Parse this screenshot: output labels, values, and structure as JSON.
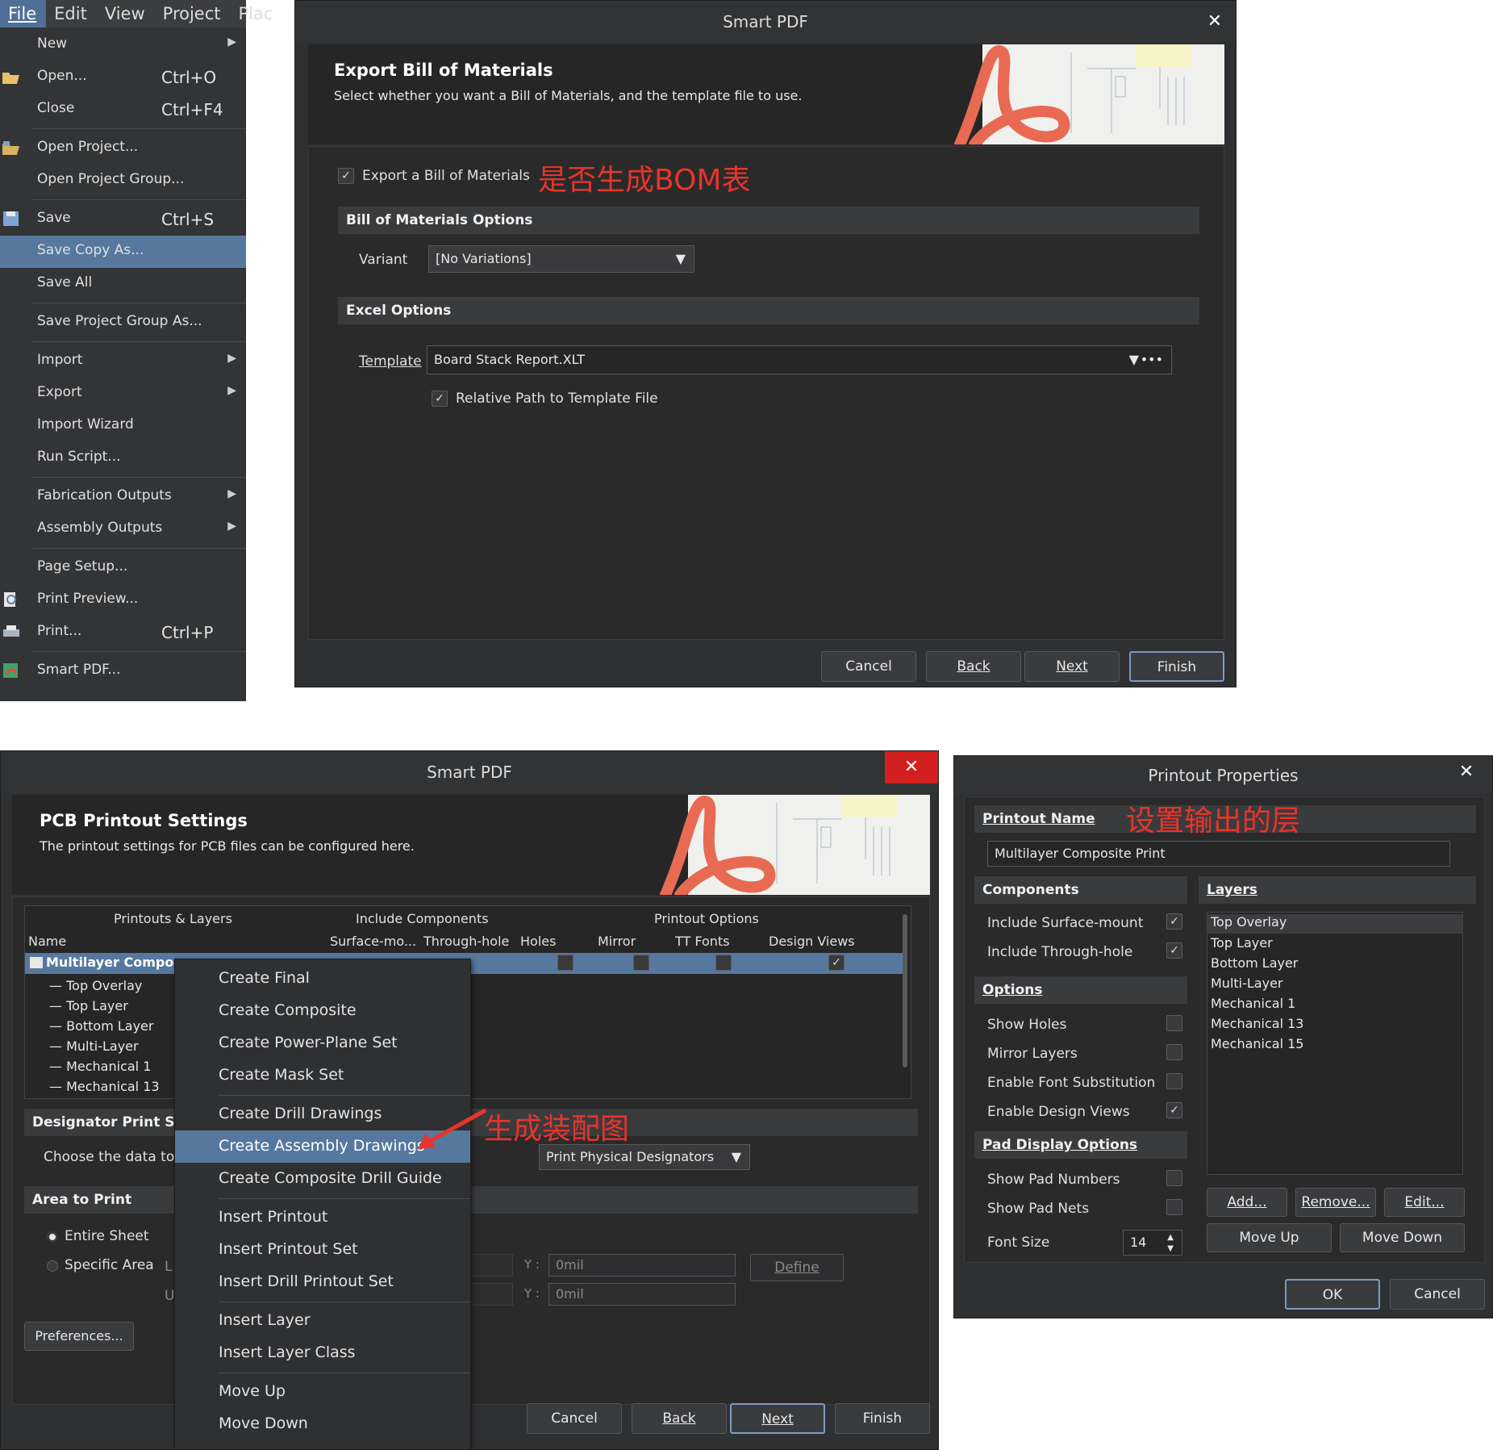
{
  "menubar": {
    "items": [
      "File",
      "Edit",
      "View",
      "Project",
      "Plac"
    ]
  },
  "file_menu": {
    "items": [
      {
        "label": "New",
        "shortcut": "",
        "submenu": true
      },
      {
        "label": "Open...",
        "shortcut": "Ctrl+O",
        "submenu": false
      },
      {
        "label": "Close",
        "shortcut": "Ctrl+F4",
        "submenu": false
      },
      {
        "label": "Open Project...",
        "shortcut": "",
        "submenu": false
      },
      {
        "label": "Open Project Group...",
        "shortcut": "",
        "submenu": false
      },
      {
        "label": "Save",
        "shortcut": "Ctrl+S",
        "submenu": false
      },
      {
        "label": "Save Copy As...",
        "shortcut": "",
        "submenu": false
      },
      {
        "label": "Save All",
        "shortcut": "",
        "submenu": false
      },
      {
        "label": "Save Project Group As...",
        "shortcut": "",
        "submenu": false
      },
      {
        "label": "Import",
        "shortcut": "",
        "submenu": true
      },
      {
        "label": "Export",
        "shortcut": "",
        "submenu": true
      },
      {
        "label": "Import Wizard",
        "shortcut": "",
        "submenu": false
      },
      {
        "label": "Run Script...",
        "shortcut": "",
        "submenu": false
      },
      {
        "label": "Fabrication Outputs",
        "shortcut": "",
        "submenu": true
      },
      {
        "label": "Assembly Outputs",
        "shortcut": "",
        "submenu": true
      },
      {
        "label": "Page Setup...",
        "shortcut": "",
        "submenu": false
      },
      {
        "label": "Print Preview...",
        "shortcut": "",
        "submenu": false
      },
      {
        "label": "Print...",
        "shortcut": "Ctrl+P",
        "submenu": false
      },
      {
        "label": "Smart PDF...",
        "shortcut": "",
        "submenu": false
      }
    ],
    "highlighted": "Save Copy As..."
  },
  "bom_dialog": {
    "title": "Smart PDF",
    "close": "✕",
    "header_title": "Export Bill of Materials",
    "header_sub": "Select whether you want a Bill of Materials, and the template file to use.",
    "export_bom_label": "Export a Bill of Materials",
    "export_bom_checked": true,
    "annotation": "是否生成BOM表",
    "bom_options_title": "Bill of Materials Options",
    "variant_label": "Variant",
    "variant_value": "[No Variations]",
    "excel_options_title": "Excel Options",
    "template_label": "Template",
    "template_value": "Board Stack Report.XLT",
    "relative_path_label": "Relative Path to Template File",
    "relative_path_checked": true,
    "buttons": {
      "cancel": "Cancel",
      "back": "Back",
      "next": "Next",
      "finish": "Finish"
    }
  },
  "pcb_dialog": {
    "title": "Smart PDF",
    "close": "✕",
    "header_title": "PCB Printout Settings",
    "header_sub": "The printout settings for PCB files can be configured here.",
    "group_headers": [
      "Printouts & Layers",
      "Include Components",
      "Printout Options"
    ],
    "columns": [
      "Name",
      "Surface-mo...",
      "Through-hole",
      "Holes",
      "Mirror",
      "TT Fonts",
      "Design Views"
    ],
    "tree_root": "Multilayer Compos",
    "tree_children": [
      "Top Overlay",
      "Top Layer",
      "Bottom Layer",
      "Multi-Layer",
      "Mechanical 1",
      "Mechanical 13"
    ],
    "designator_section": "Designator Print Setti",
    "choose_data_label": "Choose the data to",
    "designator_combo": "Print Physical Designators",
    "area_section": "Area to Print",
    "area_options": [
      "Entire Sheet",
      "Specific Area"
    ],
    "area_selected": "Entire Sheet",
    "lower_left_label": "L",
    "upper_right_label": "U",
    "y_label": "Y :",
    "y_value_1": "0mil",
    "y_value_2": "0mil",
    "define_button": "Define",
    "preferences_button": "Preferences...",
    "buttons": {
      "cancel": "Cancel",
      "back": "Back",
      "next": "Next",
      "finish": "Finish"
    },
    "annotation": "生成装配图"
  },
  "context_menu": {
    "items": [
      "Create Final",
      "Create Composite",
      "Create Power-Plane Set",
      "Create Mask Set",
      "Create Drill Drawings",
      "Create Assembly Drawings",
      "Create Composite Drill Guide",
      "Insert Printout",
      "Insert Printout Set",
      "Insert Drill Printout Set",
      "Insert Layer",
      "Insert Layer Class",
      "Move Up",
      "Move Down"
    ],
    "highlighted": "Create Assembly Drawings"
  },
  "printout_props": {
    "title": "Printout Properties",
    "close": "✕",
    "name_section": "Printout Name",
    "name_value": "Multilayer Composite Print",
    "annotation": "设置输出的层",
    "components_section": "Components",
    "include_smt": "Include Surface-mount",
    "include_th": "Include Through-hole",
    "options_section": "Options",
    "show_holes": "Show Holes",
    "mirror_layers": "Mirror Layers",
    "font_subst": "Enable Font Substitution",
    "design_views": "Enable Design Views",
    "pad_section": "Pad Display Options",
    "show_pad_numbers": "Show Pad Numbers",
    "show_pad_nets": "Show Pad Nets",
    "font_size_label": "Font Size",
    "font_size_value": "14",
    "layers_section": "Layers",
    "layers": [
      "Top Overlay",
      "Top Layer",
      "Bottom Layer",
      "Multi-Layer",
      "Mechanical 1",
      "Mechanical 13",
      "Mechanical 15"
    ],
    "layers_selected": "Top Overlay",
    "add": "Add...",
    "remove": "Remove...",
    "edit": "Edit...",
    "move_up": "Move Up",
    "move_down": "Move Down",
    "ok": "OK",
    "cancel": "Cancel"
  },
  "colors": {
    "accent": "#56789e",
    "annotation": "#e8342a",
    "dialog_bg": "#2f3032",
    "header_bg": "#262627"
  }
}
